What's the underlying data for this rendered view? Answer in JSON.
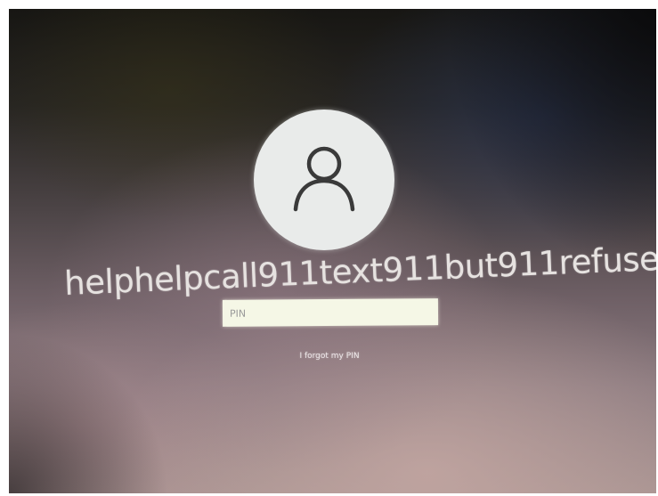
{
  "lock_screen": {
    "user_name": "helphelpcall911text911but911refuse...",
    "avatar_icon": "user-icon",
    "pin_field": {
      "placeholder": "PIN",
      "value": ""
    },
    "forgot_pin_link": "I forgot my PIN"
  },
  "colors": {
    "avatar_background": "#e9ebea",
    "avatar_glyph": "#3a3a3a",
    "pin_field_background": "#f5f7e6",
    "text": "#e6e2e0"
  }
}
